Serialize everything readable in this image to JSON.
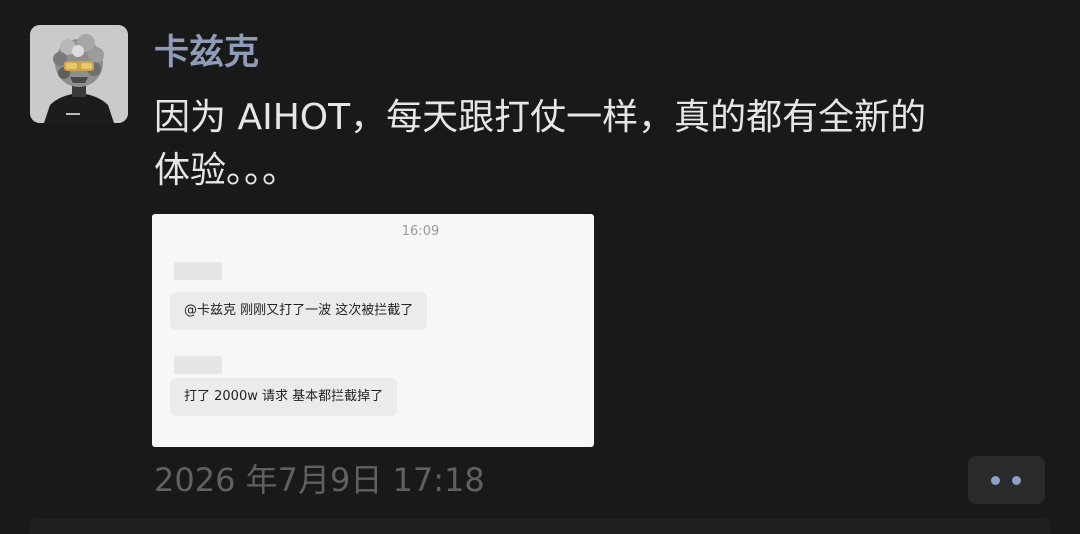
{
  "post": {
    "username": "卡兹克",
    "message_lines": [
      "因为 AIHOT，每天跟打仗一样，真的都有全新的",
      "体验。。。"
    ],
    "timestamp": "2026 年7月9日 17:18"
  },
  "screenshot": {
    "time": "16:09",
    "messages": [
      "@卡兹克 刚刚又打了一波 这次被拦截了",
      "打了 2000w 请求 基本都拦截掉了"
    ]
  },
  "colors": {
    "background": "#191919",
    "username": "#8e9cb8",
    "message_text": "#e6e6e6",
    "timestamp": "#606060",
    "more_dots": "#8da0c5"
  },
  "icons": {
    "more": "more-dots-icon",
    "avatar": "avatar-image"
  }
}
